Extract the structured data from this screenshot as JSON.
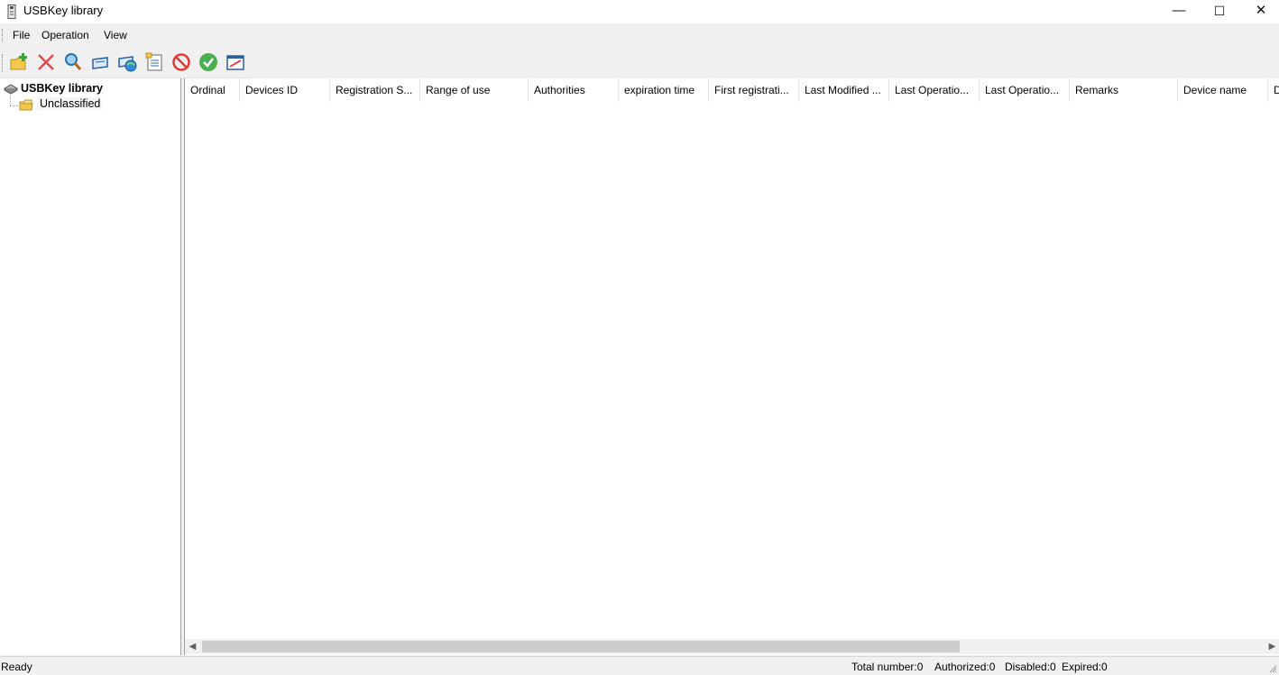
{
  "window": {
    "title": "USBKey library",
    "minimize_glyph": "—",
    "maximize_glyph": "☐",
    "close_glyph": "✕"
  },
  "menu": {
    "items": [
      "File",
      "Operation",
      "View"
    ]
  },
  "toolbar": {
    "buttons": [
      {
        "icon": "add-folder-icon"
      },
      {
        "icon": "delete-icon"
      },
      {
        "icon": "search-icon"
      },
      {
        "icon": "usbkey-icon"
      },
      {
        "icon": "usbkey-network-icon"
      },
      {
        "icon": "properties-icon"
      },
      {
        "icon": "disable-icon"
      },
      {
        "icon": "authorize-icon"
      },
      {
        "icon": "edit-icon"
      }
    ]
  },
  "tree": {
    "root_label": "USBKey library",
    "child_label": "Unclassified"
  },
  "table": {
    "columns": [
      "Ordinal",
      "Devices ID",
      "Registration S...",
      "Range of use",
      "Authorities",
      "expiration time",
      "First registrati...",
      "Last Modified ...",
      "Last Operatio...",
      "Last Operatio...",
      "Remarks",
      "Device name",
      "D"
    ],
    "rows": []
  },
  "status": {
    "ready": "Ready",
    "total": "Total number:0",
    "authorized": "Authorized:0",
    "disabled": "Disabled:0",
    "expired": "Expired:0"
  },
  "colors": {
    "window_bg": "#f0f0f0",
    "panel_bg": "#ffffff",
    "folder": "#f2c94c",
    "delete": "#e04a4a",
    "disable": "#e0392f",
    "authorize": "#4caf50"
  }
}
